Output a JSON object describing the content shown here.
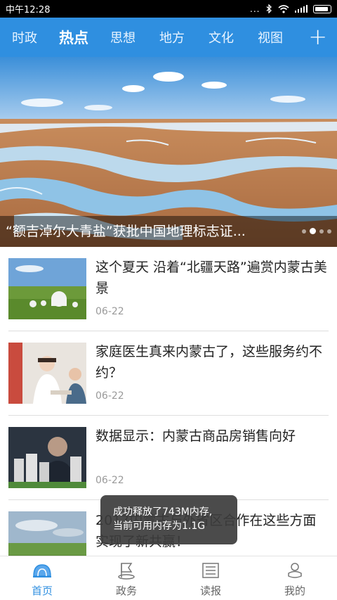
{
  "status_bar": {
    "time": "中午12:28",
    "dots": "..."
  },
  "tabs": [
    {
      "label": "时政",
      "active": false
    },
    {
      "label": "热点",
      "active": true
    },
    {
      "label": "思想",
      "active": false
    },
    {
      "label": "地方",
      "active": false
    },
    {
      "label": "文化",
      "active": false
    },
    {
      "label": "视图",
      "active": false
    }
  ],
  "add_tab_label": "+",
  "banner": {
    "caption": "“额吉淖尔大青盐”获批中国地理标志证...",
    "slide_count": 4,
    "active_slide": 2
  },
  "news": [
    {
      "title": "这个夏天 沿着“北疆天路”遍赏内蒙古美景",
      "date": "06-22"
    },
    {
      "title": "家庭医生真来内蒙古了，这些服务约不约？",
      "date": "06-22"
    },
    {
      "title": "数据显示：内蒙古商品房销售向好",
      "date": "06-22"
    },
    {
      "title": "2017内蒙古与外省区合作在这些方面实现了新共赢！",
      "date": ""
    }
  ],
  "toast": {
    "line1": "成功释放了743M内存,",
    "line2": "当前可用内存为1.1G"
  },
  "bottom_nav": [
    {
      "label": "首页",
      "icon": "home-dome-icon",
      "active": true
    },
    {
      "label": "政务",
      "icon": "government-icon",
      "active": false
    },
    {
      "label": "读报",
      "icon": "newspaper-icon",
      "active": false
    },
    {
      "label": "我的",
      "icon": "profile-icon",
      "active": false
    }
  ],
  "colors": {
    "accent": "#2f8fe0",
    "status_bar": "#000000",
    "text": "#222222",
    "date": "#9a9a9a"
  }
}
